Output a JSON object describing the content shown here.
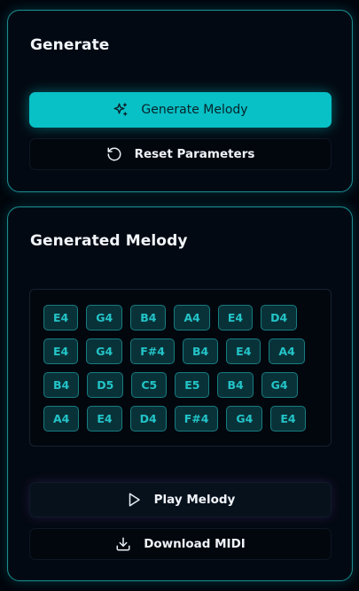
{
  "generate_card": {
    "title": "Generate",
    "generate_button": {
      "label": "Generate Melody",
      "icon": "sparkles-icon"
    },
    "reset_button": {
      "label": "Reset Parameters",
      "icon": "rotate-ccw-icon"
    }
  },
  "melody_card": {
    "title": "Generated Melody",
    "rows": [
      [
        "E4",
        "G4",
        "B4",
        "A4",
        "E4",
        "D4"
      ],
      [
        "E4",
        "G4",
        "F#4",
        "B4",
        "E4",
        "A4"
      ],
      [
        "B4",
        "D5",
        "C5",
        "E5",
        "B4",
        "G4"
      ],
      [
        "A4",
        "E4",
        "D4",
        "F#4",
        "G4",
        "E4"
      ]
    ],
    "play_button": {
      "label": "Play Melody",
      "icon": "play-icon"
    },
    "download_button": {
      "label": "Download MIDI",
      "icon": "download-icon"
    }
  },
  "colors": {
    "accent": "#08c1c6",
    "note_bg": "#093238",
    "note_text": "#23c4c8",
    "card_border": "#1c8c8f",
    "background": "#01050c"
  }
}
